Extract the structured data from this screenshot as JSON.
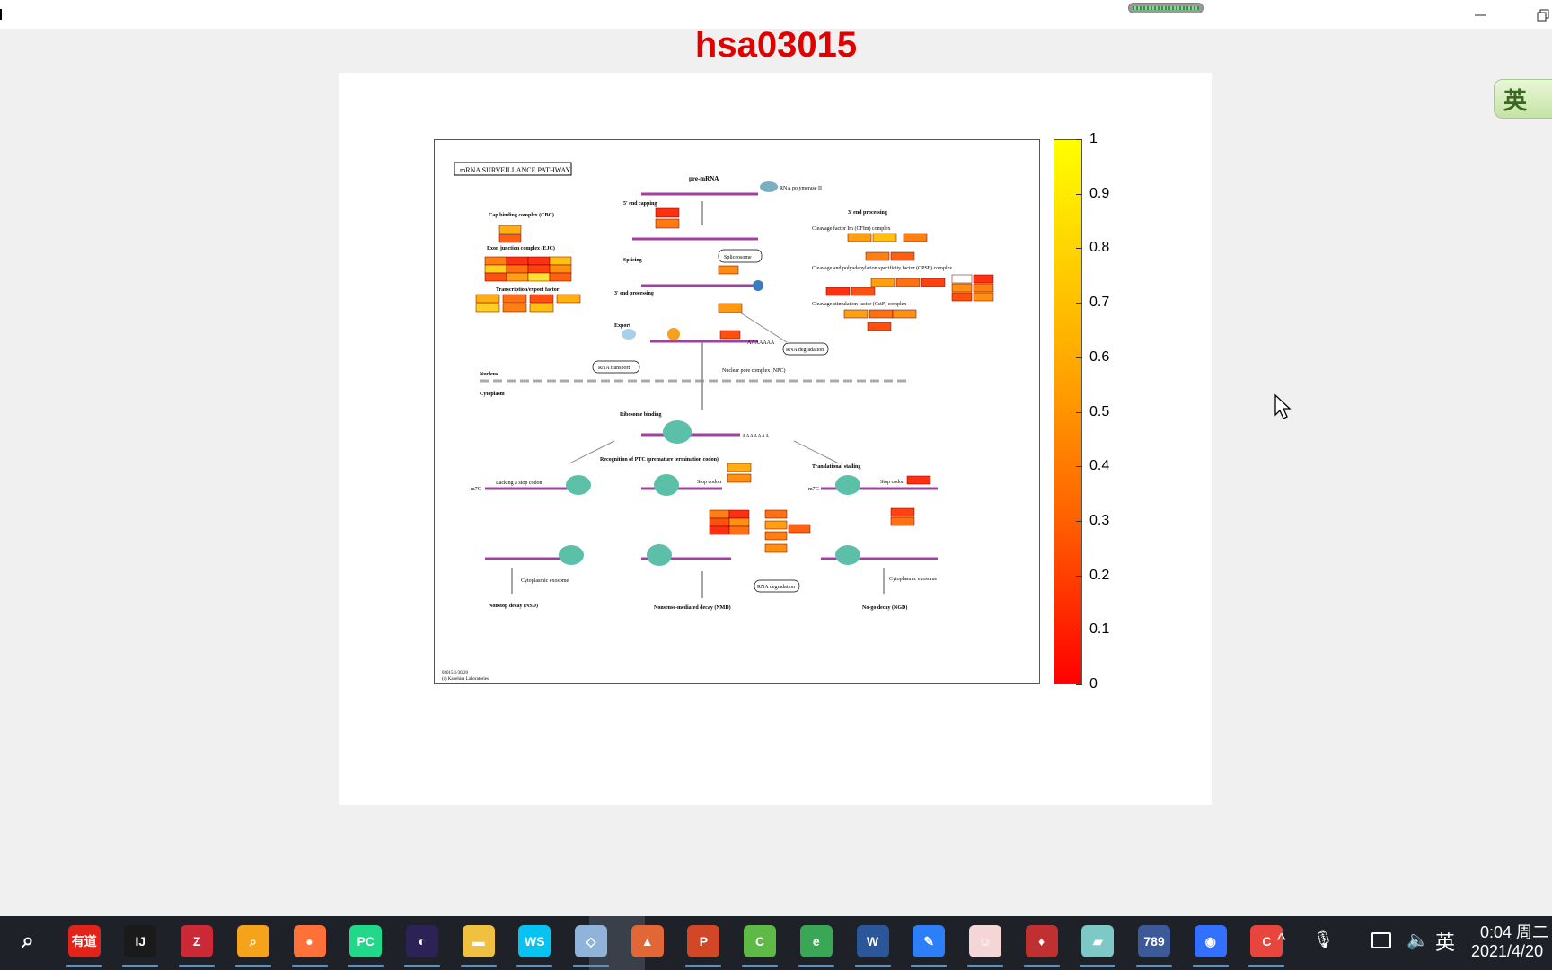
{
  "window": {
    "marker": "|"
  },
  "figure": {
    "title": "hsa03015",
    "pathway_title": "mRNA SURVEILLANCE PATHWAY",
    "pathway_footer_1": "03015 1/30/20",
    "pathway_footer_2": "(c) Kanehisa Laboratories",
    "labels": {
      "pre_mrna": "pre-mRNA",
      "rna_pol": "RNA polymerase II",
      "capping": "5' end capping",
      "splicing": "Splicing",
      "end_processing": "3' end processing",
      "export": "Export",
      "cbc": "Cap binding complex (CBC)",
      "ejc": "Exon junction complex (EJC)",
      "tef": "Transcription/export factor",
      "nucleus": "Nucleus",
      "cytoplasm": "Cytoplasm",
      "rna_transport": "RNA transport",
      "npc": "Nuclear pore complex (NPC)",
      "ribosome_binding": "Ribosome binding",
      "ptc": "Recognition of PTC (premature termination codon)",
      "lacking_stop": "Lacking a stop codon",
      "translational_stalling": "Translational stalling",
      "stop_codon": "Stop codon",
      "nonstop_decay": "Nonstop decay (NSD)",
      "nmd": "Nonsense-mediated decay (NMD)",
      "nogo_decay": "No-go decay (NGD)",
      "cytoplasmic_exosome": "Cytoplasmic exosome",
      "mrna_degradation": "RNA degradation",
      "cleavage_factor": "Cleavage factor Im (CFIm) complex",
      "cpsf": "Cleavage and polyadenylation specificity factor (CPSF) complex",
      "cstf": "Cleavage stimulation factor (CstF) complex",
      "polya_tail": "AAAAAAA",
      "m7g": "m7G",
      "spliceosome": "Spliceosome",
      "degradation_box": "RNA degradation"
    }
  },
  "colorbar": {
    "ticks": [
      "1",
      "0.9",
      "0.8",
      "0.7",
      "0.6",
      "0.5",
      "0.4",
      "0.3",
      "0.2",
      "0.1",
      "0"
    ],
    "min_color": "#ff0000",
    "max_color": "#ffff00"
  },
  "ime": {
    "label": "英"
  },
  "taskbar": {
    "apps": [
      {
        "name": "search-icon",
        "label": "⌕",
        "color": "#1e2228"
      },
      {
        "name": "youdao-icon",
        "label": "有道",
        "color": "#e2231a"
      },
      {
        "name": "intellij-icon",
        "label": "IJ",
        "color": "#1a1a1a"
      },
      {
        "name": "zotero-icon",
        "label": "Z",
        "color": "#cc2936"
      },
      {
        "name": "everything-icon",
        "label": "⌕",
        "color": "#f5a31a"
      },
      {
        "name": "firefox-icon",
        "label": "●",
        "color": "#ff7139"
      },
      {
        "name": "pycharm-icon",
        "label": "PC",
        "color": "#21d789"
      },
      {
        "name": "eclipse-icon",
        "label": "◐",
        "color": "#2c2255"
      },
      {
        "name": "explorer-icon",
        "label": "▬",
        "color": "#f0c040"
      },
      {
        "name": "webstorm-icon",
        "label": "WS",
        "color": "#07c3f2"
      },
      {
        "name": "virtualbox-icon",
        "label": "◇",
        "color": "#8fb3d9"
      },
      {
        "name": "matlab-icon",
        "label": "▲",
        "color": "#e16737"
      },
      {
        "name": "powerpoint-icon",
        "label": "P",
        "color": "#d24726"
      },
      {
        "name": "camtasia-icon",
        "label": "C",
        "color": "#5fb946"
      },
      {
        "name": "browser-icon",
        "label": "e",
        "color": "#3aa757"
      },
      {
        "name": "word-icon",
        "label": "W",
        "color": "#2b579a"
      },
      {
        "name": "pen-icon",
        "label": "✎",
        "color": "#2d7ff9"
      },
      {
        "name": "avatar-icon",
        "label": "☺",
        "color": "#f4d6d6"
      },
      {
        "name": "hero-icon",
        "label": "♦",
        "color": "#c03030"
      },
      {
        "name": "notes-icon",
        "label": "▰",
        "color": "#7ec8c8"
      },
      {
        "name": "app-789-icon",
        "label": "789",
        "color": "#3c5a9a"
      },
      {
        "name": "feishu-icon",
        "label": "◉",
        "color": "#3370ff"
      },
      {
        "name": "capture-icon",
        "label": "C",
        "color": "#e8453c"
      }
    ],
    "clock_time": "0:04 周二",
    "clock_date": "2021/4/20",
    "lang": "英",
    "tray_arrow": "^"
  }
}
